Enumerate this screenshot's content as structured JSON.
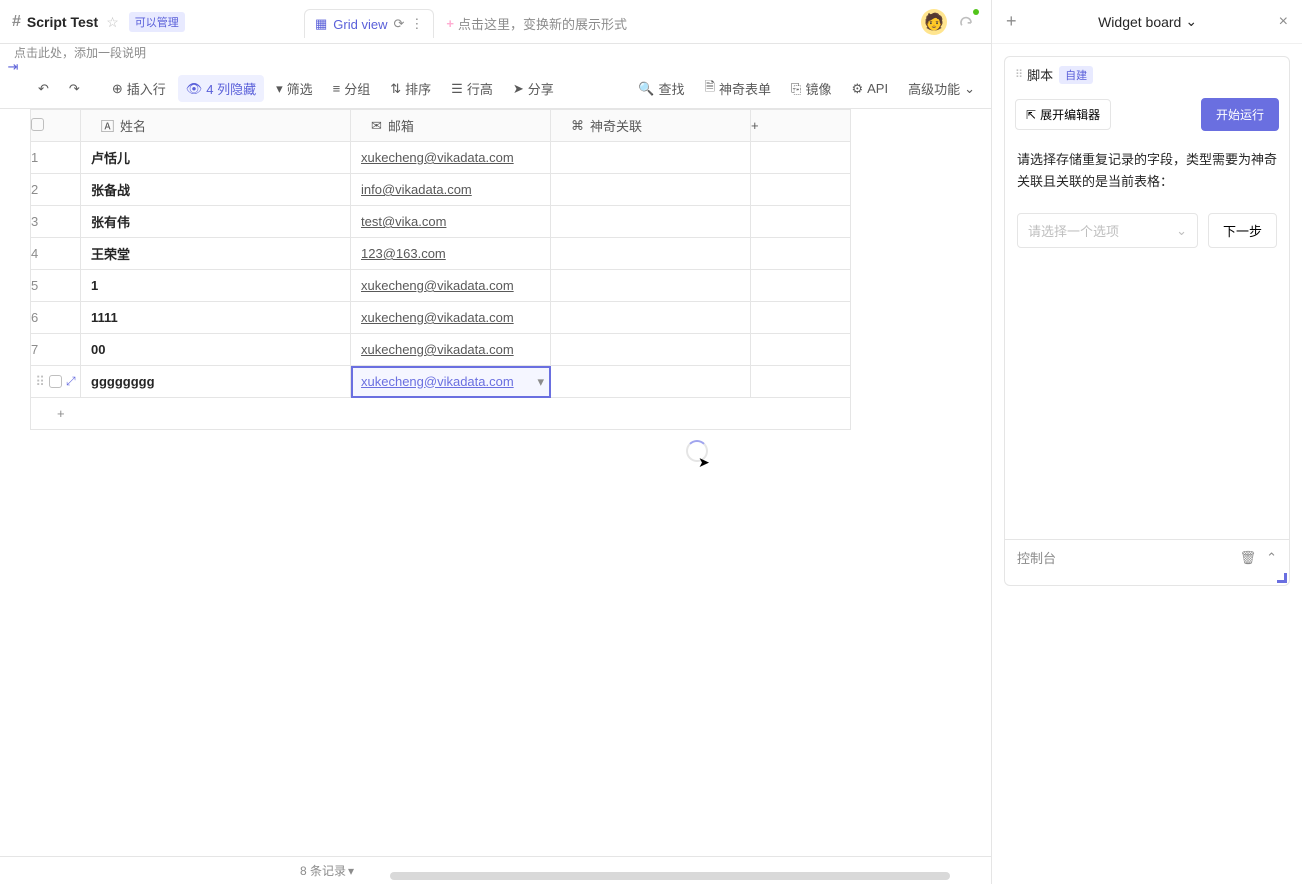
{
  "header": {
    "title": "Script Test",
    "badge": "可以管理",
    "subtitle": "点击此处，添加一段说明"
  },
  "viewtab": {
    "label": "Grid view",
    "hint": "点击这里，变换新的展示形式"
  },
  "toolbar": {
    "insert_row": "插入行",
    "hidden_cols": "4 列隐藏",
    "filter": "筛选",
    "group": "分组",
    "sort": "排序",
    "rowheight": "行高",
    "share": "分享",
    "find": "查找",
    "magic_form": "神奇表单",
    "mirror": "镜像",
    "api": "API",
    "advanced": "高级功能"
  },
  "columns": {
    "name": "姓名",
    "email": "邮箱",
    "magic_link": "神奇关联"
  },
  "rows": [
    {
      "n": "1",
      "name": "卢恬儿",
      "email": "xukecheng@vikadata.com"
    },
    {
      "n": "2",
      "name": "张备战",
      "email": "info@vikadata.com"
    },
    {
      "n": "3",
      "name": "张有伟",
      "email": "test@vika.com"
    },
    {
      "n": "4",
      "name": "王荣堂",
      "email": "123@163.com"
    },
    {
      "n": "5",
      "name": "1",
      "email": "xukecheng@vikadata.com"
    },
    {
      "n": "6",
      "name": "1111",
      "email": "xukecheng@vikadata.com"
    },
    {
      "n": "7",
      "name": "00",
      "email": "xukecheng@vikadata.com"
    },
    {
      "n": "",
      "name": "gggggggg",
      "email": "xukecheng@vikadata.com",
      "selected": true
    }
  ],
  "footer": {
    "count": "8 条记录"
  },
  "widget_panel": {
    "title": "Widget board",
    "script_label": "脚本",
    "self_built": "自建",
    "expand_editor": "展开编辑器",
    "start_run": "开始运行",
    "prompt": "请选择存储重复记录的字段，类型需要为神奇关联且关联的是当前表格：",
    "select_placeholder": "请选择一个选项",
    "next": "下一步",
    "console": "控制台"
  }
}
